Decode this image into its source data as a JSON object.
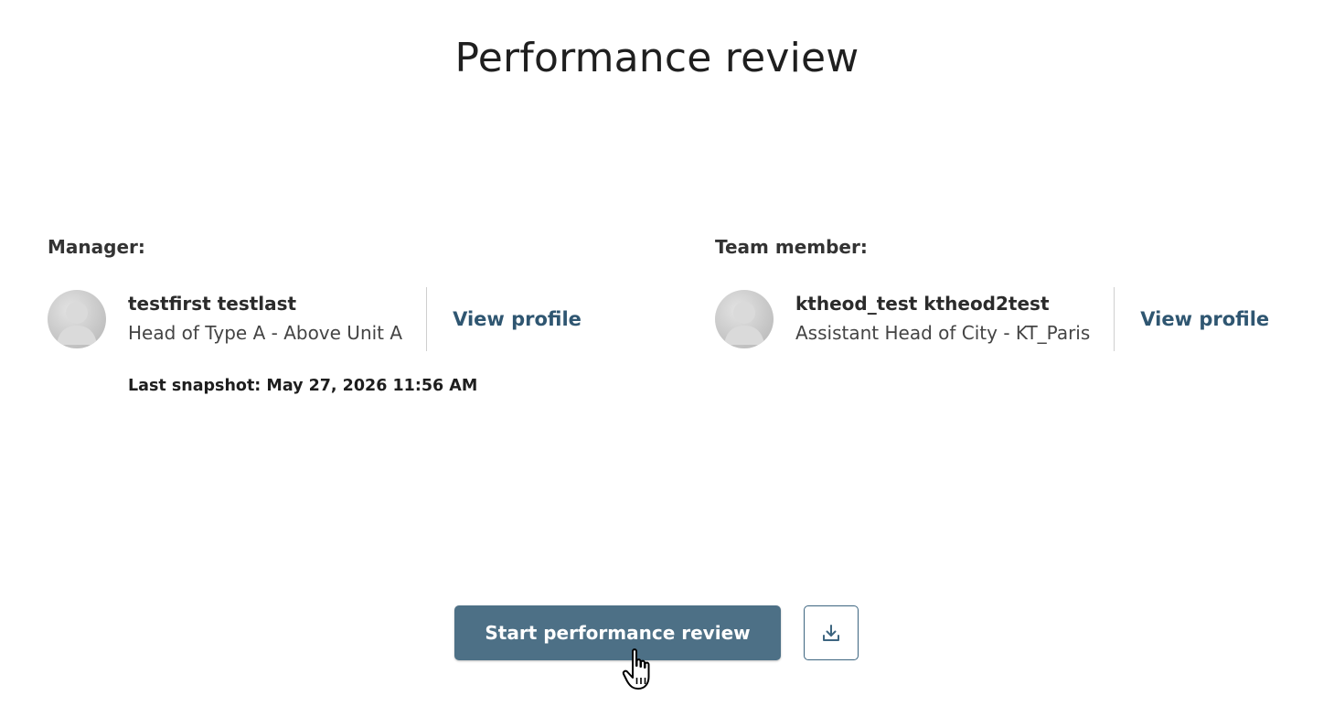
{
  "page": {
    "title": "Performance review"
  },
  "manager": {
    "heading": "Manager:",
    "name": "testfirst testlast",
    "role": "Head of Type A - Above Unit A",
    "view_profile_label": "View profile",
    "avatar_icon": "default-avatar-icon"
  },
  "team_member": {
    "heading": "Team member:",
    "name": "ktheod_test ktheod2test",
    "role": "Assistant Head of City - KT_Paris",
    "view_profile_label": "View profile",
    "avatar_icon": "default-avatar-icon"
  },
  "snapshot": {
    "text": "Last snapshot: May 27, 2026 11:56 AM"
  },
  "actions": {
    "start_label": "Start performance review",
    "download_icon": "download-icon"
  },
  "colors": {
    "primary": "#4d7086",
    "link": "#2f5671",
    "divider": "#cfcfcf"
  }
}
